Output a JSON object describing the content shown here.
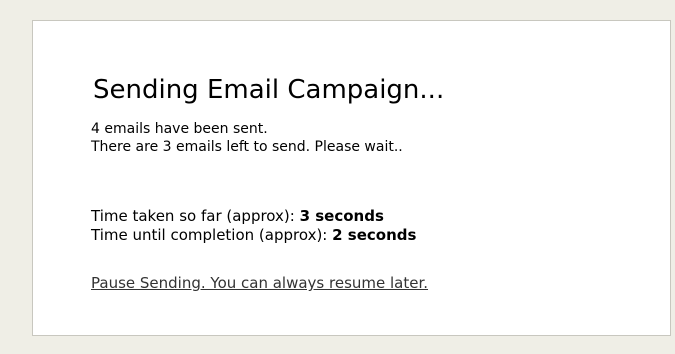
{
  "dialog": {
    "title": "Sending Email Campaign...",
    "status_sent": "4 emails have been sent.",
    "status_remaining": "There are 3 emails left to send. Please wait..",
    "time_taken_label": "Time taken so far (approx):",
    "time_taken_value": "3 seconds",
    "time_remaining_label": "Time until completion (approx):",
    "time_remaining_value": "2 seconds",
    "pause_link": "Pause Sending. You can always resume later."
  }
}
